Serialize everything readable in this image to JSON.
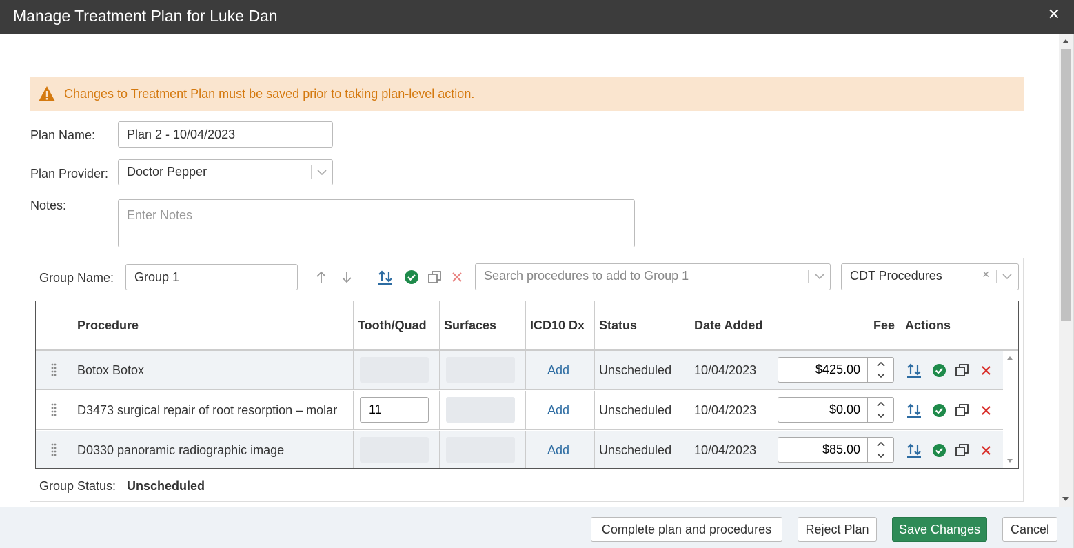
{
  "dialog": {
    "title": "Manage Treatment Plan for Luke Dan",
    "close_icon": "✕"
  },
  "alert": {
    "message": "Changes to Treatment Plan must be saved prior to taking plan-level action.",
    "color": "#d4790f",
    "background": "#fae5cf"
  },
  "form": {
    "plan_name_label": "Plan Name:",
    "plan_name_value": "Plan 2 - 10/04/2023",
    "plan_provider_label": "Plan Provider:",
    "plan_provider_value": "Doctor Pepper",
    "notes_label": "Notes:",
    "notes_placeholder": "Enter Notes"
  },
  "group": {
    "name_label": "Group Name:",
    "name_value": "Group 1",
    "search_placeholder": "Search procedures to add to Group 1",
    "procedure_set_value": "CDT Procedures",
    "clear_icon": "×",
    "status_label": "Group Status:",
    "status_value": "Unscheduled"
  },
  "table": {
    "headers": {
      "procedure": "Procedure",
      "tooth_quad": "Tooth/Quad",
      "surfaces": "Surfaces",
      "icd10": "ICD10 Dx",
      "status": "Status",
      "date_added": "Date Added",
      "fee": "Fee",
      "actions": "Actions"
    },
    "rows": [
      {
        "procedure": "Botox Botox",
        "tooth": "",
        "icd_link": "Add",
        "status": "Unscheduled",
        "date_added": "10/04/2023",
        "fee": "$425.00"
      },
      {
        "procedure": "D3473 surgical repair of root resorption – molar",
        "tooth": "11",
        "icd_link": "Add",
        "status": "Unscheduled",
        "date_added": "10/04/2023",
        "fee": "$0.00"
      },
      {
        "procedure": "D0330 panoramic radiographic image",
        "tooth": "",
        "icd_link": "Add",
        "status": "Unscheduled",
        "date_added": "10/04/2023",
        "fee": "$85.00"
      }
    ]
  },
  "footer": {
    "complete_label": "Complete plan and procedures",
    "reject_label": "Reject Plan",
    "save_label": "Save Changes",
    "cancel_label": "Cancel"
  },
  "colors": {
    "title_bar": "#3c3c3c",
    "primary": "#2e8b57",
    "link": "#2d6ca2",
    "success": "#1e8a4a",
    "danger": "#d9302c"
  }
}
